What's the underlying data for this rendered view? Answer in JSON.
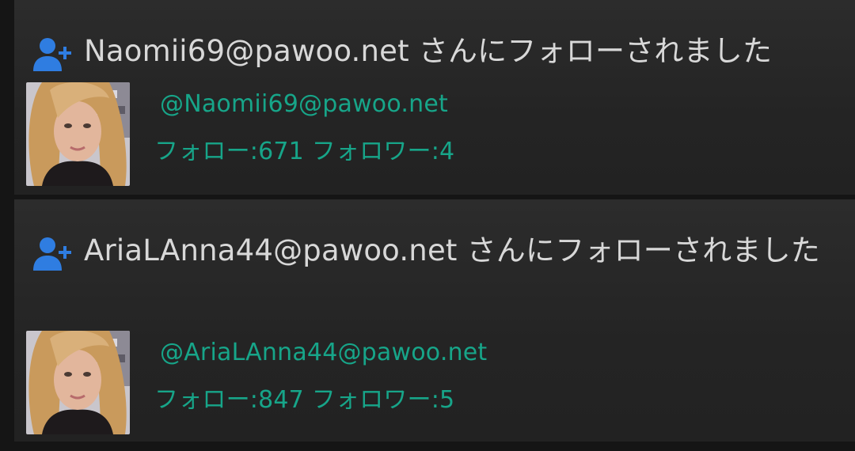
{
  "notifications": [
    {
      "icon": "person-add-icon",
      "message": "Naomii69@pawoo.net さんにフォローされました",
      "handle": "@Naomii69@pawoo.net",
      "stats": "フォロー:671 フォロワー:4"
    },
    {
      "icon": "person-add-icon",
      "message": "AriaLAnna44@pawoo.net さんにフォローされました",
      "handle": "@AriaLAnna44@pawoo.net",
      "stats": "フォロー:847 フォロワー:5"
    }
  ],
  "colors": {
    "background": "#151515",
    "card": "#262626",
    "accent": "#17a589",
    "icon": "#2f7de1",
    "text": "#d8d8d8"
  }
}
